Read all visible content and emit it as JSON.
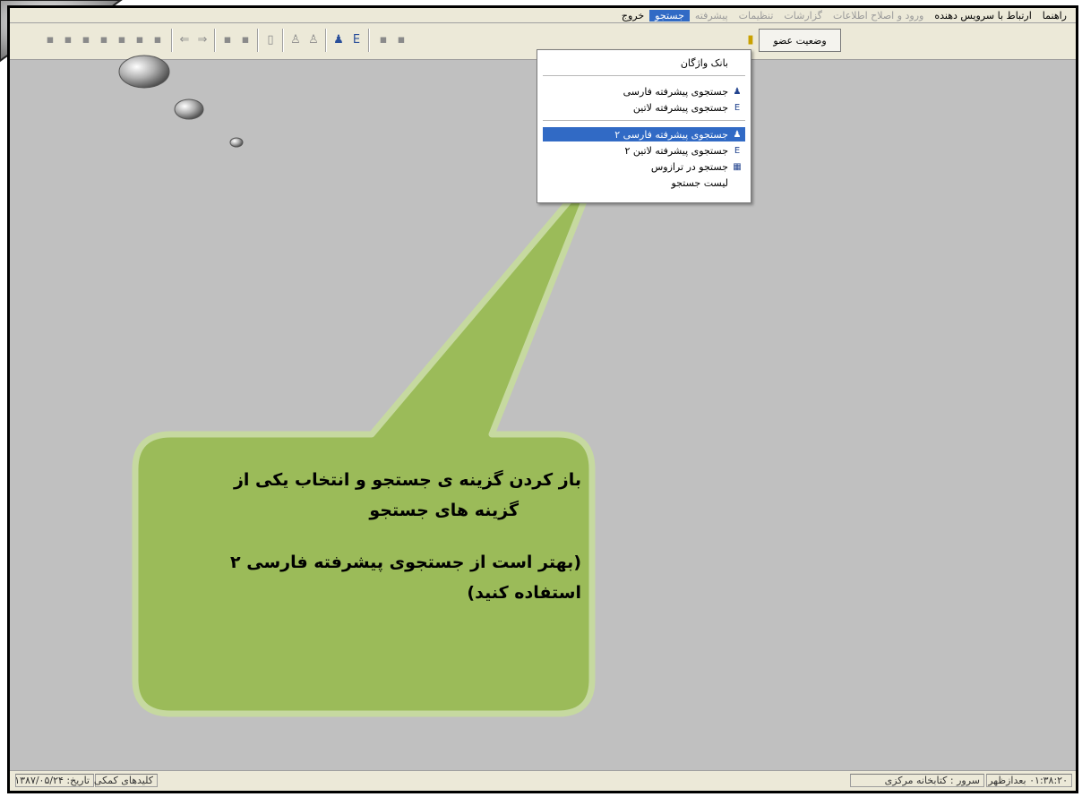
{
  "menubar": {
    "items": [
      {
        "label": "راهنما",
        "state": "normal"
      },
      {
        "label": "ارتباط با سرویس دهنده",
        "state": "normal"
      },
      {
        "label": "ورود و اصلاح اطلاعات",
        "state": "disabled"
      },
      {
        "label": "گزارشات",
        "state": "disabled"
      },
      {
        "label": "تنظیمات",
        "state": "disabled"
      },
      {
        "label": "پیشرفته",
        "state": "disabled"
      },
      {
        "label": "جستجو",
        "state": "active"
      },
      {
        "label": "خروج",
        "state": "normal"
      }
    ]
  },
  "toolbar": {
    "member_status_label": "وضعیت عضو"
  },
  "search_menu": {
    "items": [
      {
        "label": "بانک واژگان",
        "icon": "none"
      },
      {
        "label": "جستجوی پیشرفته فارسی",
        "icon": "search-fa-icon"
      },
      {
        "label": "جستجوی پیشرفته لاتین",
        "icon": "search-en-icon"
      },
      {
        "label": "جستجوی پیشرفته فارسی ۲",
        "icon": "search-fa-icon",
        "highlighted": true
      },
      {
        "label": "جستجوی پیشرفته لاتین ۲",
        "icon": "search-en-icon"
      },
      {
        "label": "جستجو در ترازوس",
        "icon": "thesaurus-icon"
      },
      {
        "label": "لیست جستجو",
        "icon": "none"
      }
    ]
  },
  "statusbar": {
    "time": "۰۱:۳۸:۲۰ بعدازظهر",
    "server": "سرور : کتابخانه مرکزی",
    "help_keys": "کلیدهای کمکی",
    "date": "تاریخ: ۱۳۸۷/۰۵/۲۴"
  },
  "callout": {
    "line1": "باز کردن گزینه ی جستجو و انتخاب یکی از",
    "line2": "گزینه های جستجو",
    "line3": "(بهتر است از جستجوی پیشرفته فارسی ۲",
    "line4": "استفاده کنید)"
  },
  "colors": {
    "callout_fill": "#9bbb59",
    "callout_border": "#c6d9a0",
    "highlight": "#316ac5",
    "workspace": "#c0c0c0"
  }
}
